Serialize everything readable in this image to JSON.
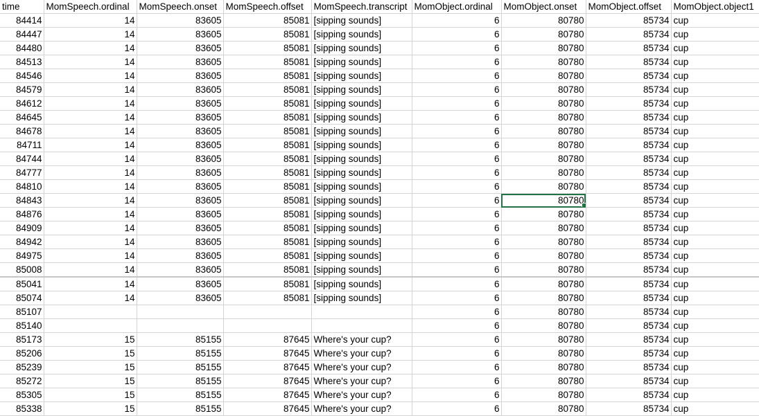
{
  "sheet": {
    "headers": [
      "time",
      "MomSpeech.ordinal",
      "MomSpeech.onset",
      "MomSpeech.offset",
      "MomSpeech.transcript",
      "MomObject.ordinal",
      "MomObject.onset",
      "MomObject.offset",
      "MomObject.object1"
    ],
    "rows": [
      [
        "84414",
        "14",
        "83605",
        "85081",
        "[sipping sounds]",
        "6",
        "80780",
        "85734",
        "cup"
      ],
      [
        "84447",
        "14",
        "83605",
        "85081",
        "[sipping sounds]",
        "6",
        "80780",
        "85734",
        "cup"
      ],
      [
        "84480",
        "14",
        "83605",
        "85081",
        "[sipping sounds]",
        "6",
        "80780",
        "85734",
        "cup"
      ],
      [
        "84513",
        "14",
        "83605",
        "85081",
        "[sipping sounds]",
        "6",
        "80780",
        "85734",
        "cup"
      ],
      [
        "84546",
        "14",
        "83605",
        "85081",
        "[sipping sounds]",
        "6",
        "80780",
        "85734",
        "cup"
      ],
      [
        "84579",
        "14",
        "83605",
        "85081",
        "[sipping sounds]",
        "6",
        "80780",
        "85734",
        "cup"
      ],
      [
        "84612",
        "14",
        "83605",
        "85081",
        "[sipping sounds]",
        "6",
        "80780",
        "85734",
        "cup"
      ],
      [
        "84645",
        "14",
        "83605",
        "85081",
        "[sipping sounds]",
        "6",
        "80780",
        "85734",
        "cup"
      ],
      [
        "84678",
        "14",
        "83605",
        "85081",
        "[sipping sounds]",
        "6",
        "80780",
        "85734",
        "cup"
      ],
      [
        "84711",
        "14",
        "83605",
        "85081",
        "[sipping sounds]",
        "6",
        "80780",
        "85734",
        "cup"
      ],
      [
        "84744",
        "14",
        "83605",
        "85081",
        "[sipping sounds]",
        "6",
        "80780",
        "85734",
        "cup"
      ],
      [
        "84777",
        "14",
        "83605",
        "85081",
        "[sipping sounds]",
        "6",
        "80780",
        "85734",
        "cup"
      ],
      [
        "84810",
        "14",
        "83605",
        "85081",
        "[sipping sounds]",
        "6",
        "80780",
        "85734",
        "cup"
      ],
      [
        "84843",
        "14",
        "83605",
        "85081",
        "[sipping sounds]",
        "6",
        "80780",
        "85734",
        "cup"
      ],
      [
        "84876",
        "14",
        "83605",
        "85081",
        "[sipping sounds]",
        "6",
        "80780",
        "85734",
        "cup"
      ],
      [
        "84909",
        "14",
        "83605",
        "85081",
        "[sipping sounds]",
        "6",
        "80780",
        "85734",
        "cup"
      ],
      [
        "84942",
        "14",
        "83605",
        "85081",
        "[sipping sounds]",
        "6",
        "80780",
        "85734",
        "cup"
      ],
      [
        "84975",
        "14",
        "83605",
        "85081",
        "[sipping sounds]",
        "6",
        "80780",
        "85734",
        "cup"
      ],
      [
        "85008",
        "14",
        "83605",
        "85081",
        "[sipping sounds]",
        "6",
        "80780",
        "85734",
        "cup"
      ],
      [
        "85041",
        "14",
        "83605",
        "85081",
        "[sipping sounds]",
        "6",
        "80780",
        "85734",
        "cup"
      ],
      [
        "85074",
        "14",
        "83605",
        "85081",
        "[sipping sounds]",
        "6",
        "80780",
        "85734",
        "cup"
      ],
      [
        "85107",
        "",
        "",
        "",
        "",
        "6",
        "80780",
        "85734",
        "cup"
      ],
      [
        "85140",
        "",
        "",
        "",
        "",
        "6",
        "80780",
        "85734",
        "cup"
      ],
      [
        "85173",
        "15",
        "85155",
        "87645",
        "Where's your cup?",
        "6",
        "80780",
        "85734",
        "cup"
      ],
      [
        "85206",
        "15",
        "85155",
        "87645",
        "Where's your cup?",
        "6",
        "80780",
        "85734",
        "cup"
      ],
      [
        "85239",
        "15",
        "85155",
        "87645",
        "Where's your cup?",
        "6",
        "80780",
        "85734",
        "cup"
      ],
      [
        "85272",
        "15",
        "85155",
        "87645",
        "Where's your cup?",
        "6",
        "80780",
        "85734",
        "cup"
      ],
      [
        "85305",
        "15",
        "85155",
        "87645",
        "Where's your cup?",
        "6",
        "80780",
        "85734",
        "cup"
      ],
      [
        "85338",
        "15",
        "85155",
        "87645",
        "Where's your cup?",
        "6",
        "80780",
        "85734",
        "cup"
      ]
    ],
    "selected_cell": {
      "row": 13,
      "col": 6
    },
    "divider_after_row": 18,
    "colors": {
      "selection_border": "#217346",
      "gridline": "#d4d4d4"
    }
  }
}
